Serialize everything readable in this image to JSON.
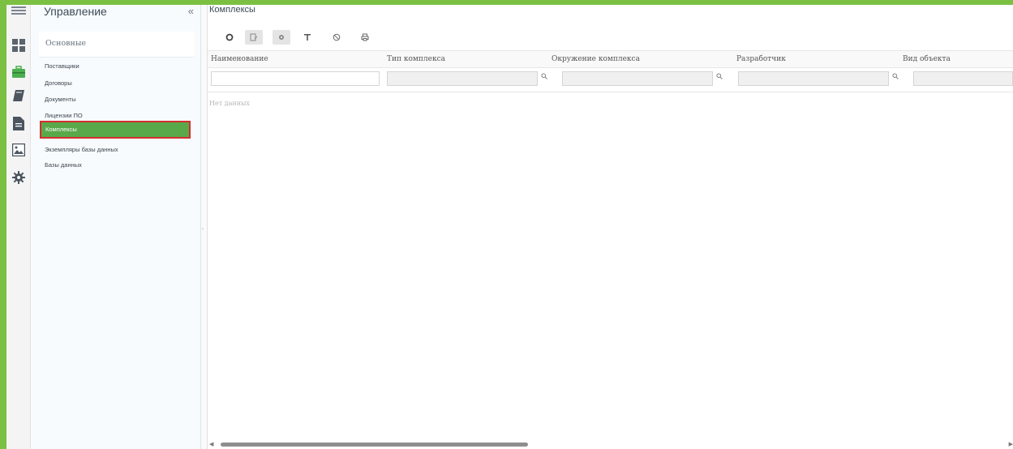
{
  "colors": {
    "accent_green": "#7bc043",
    "active_item": "#59a84a",
    "highlight_border": "#d32f2f"
  },
  "iconbar": {
    "icons": [
      "menu-icon",
      "dashboard-icon",
      "briefcase-icon",
      "book-icon",
      "document-icon",
      "image-icon",
      "gear-icon"
    ]
  },
  "sidebar": {
    "title": "Управление",
    "collapse": "«",
    "section": "Основные",
    "items": [
      {
        "label": "Поставщики"
      },
      {
        "label": "Договоры"
      },
      {
        "label": "Документы"
      },
      {
        "label": "Лицензии ПО"
      },
      {
        "label": "Комплексы"
      },
      {
        "label": "Экземпляры базы данных"
      },
      {
        "label": "Базы данных"
      }
    ]
  },
  "main": {
    "title": "Комплексы",
    "toolbar": [
      "add-icon",
      "edit-icon",
      "settings-icon",
      "filter-icon",
      "clear-filter-icon",
      "print-icon"
    ],
    "columns": [
      {
        "label": "Наименование"
      },
      {
        "label": "Тип комплекса"
      },
      {
        "label": "Окружение комплекса"
      },
      {
        "label": "Разработчик"
      },
      {
        "label": "Вид объекта"
      }
    ],
    "empty_text": "Нет данных"
  }
}
